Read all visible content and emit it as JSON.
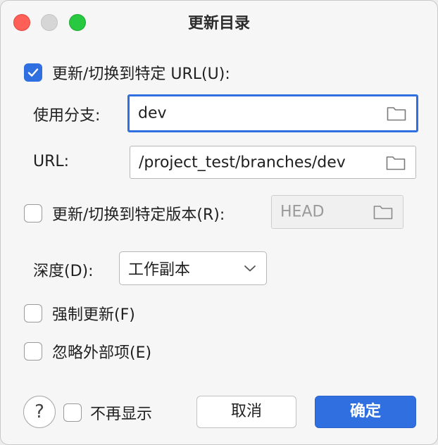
{
  "window": {
    "title": "更新目录"
  },
  "update_url": {
    "label": "更新/切换到特定 URL(U):",
    "checked": true
  },
  "branch": {
    "label": "使用分支:",
    "value": "dev"
  },
  "url": {
    "label": "URL:",
    "value": "/project_test/branches/dev"
  },
  "update_revision": {
    "label": "更新/切换到特定版本(R):",
    "checked": false,
    "value": "HEAD"
  },
  "depth": {
    "label": "深度(D):",
    "value": "工作副本"
  },
  "force_update": {
    "label": "强制更新(F)",
    "checked": false
  },
  "ignore_externals": {
    "label": "忽略外部项(E)",
    "checked": false
  },
  "footer": {
    "help": "?",
    "dont_show": "不再显示",
    "cancel": "取消",
    "ok": "确定"
  },
  "colors": {
    "accent": "#2f6fe0",
    "close": "#fe5f57",
    "maximize": "#28c840"
  },
  "icons": {
    "folder": "folder-icon",
    "chevron": "chevron-down-icon",
    "check": "check-icon"
  }
}
